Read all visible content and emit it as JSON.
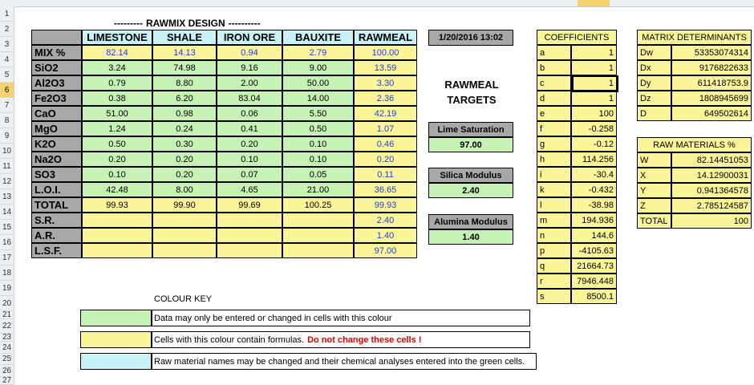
{
  "title": "RAWMIX DESIGN",
  "title_dashes_left": "---------",
  "title_dashes_right": "----------",
  "row_numbers": [
    "1",
    "2",
    "3",
    "4",
    "5",
    "6",
    "7",
    "8",
    "9",
    "10",
    "11",
    "12",
    "13",
    "14",
    "15",
    "16",
    "17",
    "18",
    "19",
    "20",
    "21",
    "22",
    "23",
    "24",
    "25",
    "26",
    "27"
  ],
  "selected_row": "6",
  "mix_table": {
    "headers": [
      "LIMESTONE",
      "SHALE",
      "IRON ORE",
      "BAUXITE",
      "RAWMEAL"
    ],
    "rows": [
      {
        "label": "MIX %",
        "values": [
          "82.14",
          "14.13",
          "0.94",
          "2.79",
          "100.00"
        ]
      },
      {
        "label": "SiO2",
        "values": [
          "3.24",
          "74.98",
          "9.16",
          "9.00",
          "13.59"
        ]
      },
      {
        "label": "Al2O3",
        "values": [
          "0.79",
          "8.80",
          "2.00",
          "50.00",
          "3.30"
        ]
      },
      {
        "label": "Fe2O3",
        "values": [
          "0.38",
          "6.20",
          "83.04",
          "14.00",
          "2.36"
        ]
      },
      {
        "label": "CaO",
        "values": [
          "51.00",
          "0.98",
          "0.06",
          "5.50",
          "42.19"
        ]
      },
      {
        "label": "MgO",
        "values": [
          "1.24",
          "0.24",
          "0.41",
          "0.50",
          "1.07"
        ]
      },
      {
        "label": "K2O",
        "values": [
          "0.50",
          "0.30",
          "0.20",
          "0.10",
          "0.46"
        ]
      },
      {
        "label": "Na2O",
        "values": [
          "0.20",
          "0.20",
          "0.10",
          "0.10",
          "0.20"
        ]
      },
      {
        "label": "SO3",
        "values": [
          "0.10",
          "0.20",
          "0.07",
          "0.05",
          "0.11"
        ]
      },
      {
        "label": "L.O.I.",
        "values": [
          "42.48",
          "8.00",
          "4.65",
          "21.00",
          "36.65"
        ]
      },
      {
        "label": "TOTAL",
        "values": [
          "99.93",
          "99.90",
          "99.69",
          "100.25",
          "99.93"
        ]
      },
      {
        "label": "S.R.",
        "values": [
          "",
          "",
          "",
          "",
          "2.40"
        ]
      },
      {
        "label": "A.R.",
        "values": [
          "",
          "",
          "",
          "",
          "1.40"
        ]
      },
      {
        "label": "L.S.F.",
        "values": [
          "",
          "",
          "",
          "",
          "97.00"
        ]
      }
    ]
  },
  "datetime": "1/20/2016 13:02",
  "targets": {
    "heading_line1": "RAWMEAL",
    "heading_line2": "TARGETS",
    "lime_saturation_label": "Lime Saturation",
    "lime_saturation_value": "97.00",
    "silica_modulus_label": "Silica Modulus",
    "silica_modulus_value": "2.40",
    "alumina_modulus_label": "Alumina Modulus",
    "alumina_modulus_value": "1.40"
  },
  "coefficients": {
    "header": "COEFFICIENTS",
    "rows": [
      {
        "k": "a",
        "v": "1"
      },
      {
        "k": "b",
        "v": "1"
      },
      {
        "k": "c",
        "v": "1"
      },
      {
        "k": "d",
        "v": "1"
      },
      {
        "k": "e",
        "v": "100"
      },
      {
        "k": "f",
        "v": "-0.258"
      },
      {
        "k": "g",
        "v": "-0.12"
      },
      {
        "k": "h",
        "v": "114.256"
      },
      {
        "k": "i",
        "v": "-30.4"
      },
      {
        "k": "k",
        "v": "-0.432"
      },
      {
        "k": "l",
        "v": "-38.98"
      },
      {
        "k": "m",
        "v": "194.936"
      },
      {
        "k": "n",
        "v": "144.6"
      },
      {
        "k": "p",
        "v": "-4105.63"
      },
      {
        "k": "q",
        "v": "21664.73"
      },
      {
        "k": "r",
        "v": "7946.448"
      },
      {
        "k": "s",
        "v": "8500.1"
      }
    ]
  },
  "determinants": {
    "header": "MATRIX DETERMINANTS",
    "rows": [
      {
        "k": "Dw",
        "v": "53353074314"
      },
      {
        "k": "Dx",
        "v": "9176822633"
      },
      {
        "k": "Dy",
        "v": "611418753.9"
      },
      {
        "k": "Dz",
        "v": "1808945699"
      },
      {
        "k": "D",
        "v": "649502614"
      }
    ]
  },
  "raw_materials": {
    "header": "RAW MATERIALS  %",
    "rows": [
      {
        "k": "W",
        "v": "82.14451053"
      },
      {
        "k": "X",
        "v": "14.12900031"
      },
      {
        "k": "Y",
        "v": "0.941364578"
      },
      {
        "k": "Z",
        "v": "2.785124587"
      },
      {
        "k": "TOTAL",
        "v": "100"
      }
    ]
  },
  "colour_key": {
    "title": "COLOUR KEY",
    "green_text": "Data may only be entered or changed in cells with this colour",
    "yellow_text": "Cells with this colour contain formulas.",
    "yellow_warning": "Do not change these cells !",
    "cyan_text": "Raw material names may be changed and their chemical analyses entered into the green cells."
  },
  "colors": {
    "input_green": "#c6f3b5",
    "formula_yellow": "#fbf59a",
    "name_cyan": "#c9f2f7",
    "label_grey": "#a8a8a8",
    "value_blue": "#1f3fd6",
    "warning_red": "#e00000"
  }
}
